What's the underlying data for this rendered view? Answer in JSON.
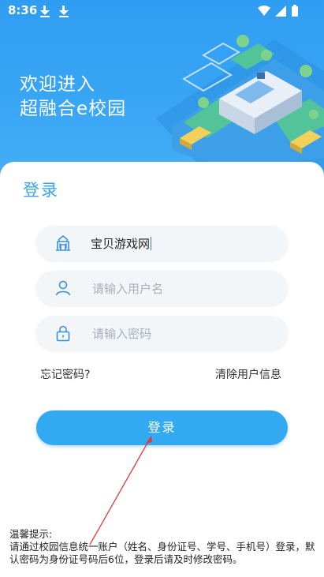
{
  "status_bar": {
    "time": "8:36"
  },
  "hero": {
    "line1": "欢迎进入",
    "line2": "超融合e校园"
  },
  "login": {
    "title": "登录",
    "school_value": "宝贝游戏网",
    "username_placeholder": "请输入用户名",
    "password_placeholder": "请输入密码",
    "forgot_label": "忘记密码?",
    "clear_label": "清除用户信息",
    "button_label": "登录"
  },
  "notice": {
    "heading": "温馨提示:",
    "body": "请通过校园信息统一账户（姓名、身份证号、学号、手机号）登录，默认密码为身份证号码后6位，登录后请及时修改密码。"
  },
  "colors": {
    "accent": "#33a9f2",
    "hero_bg": "#2f9df2",
    "annotation": "#e53935"
  }
}
